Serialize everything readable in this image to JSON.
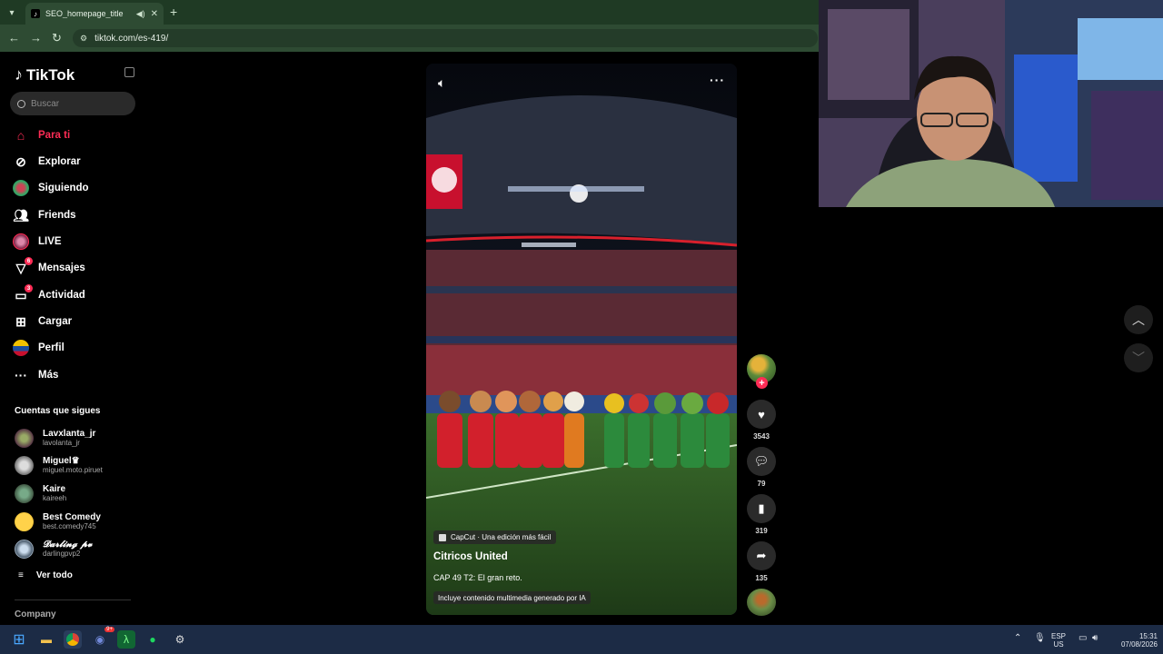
{
  "browser": {
    "tab_title": "SEO_homepage_title",
    "url": "tiktok.com/es-419/",
    "tab_icon": "tiktok-favicon",
    "new_tab": "+"
  },
  "sidebar": {
    "logo": "TikTok",
    "search_placeholder": "Buscar",
    "nav": [
      {
        "label": "Para ti",
        "icon": "home-icon",
        "active": true
      },
      {
        "label": "Explorar",
        "icon": "compass-icon"
      },
      {
        "label": "Siguiendo",
        "icon": "following-avatar-icon"
      },
      {
        "label": "Friends",
        "icon": "friends-icon"
      },
      {
        "label": "LIVE",
        "icon": "live-icon"
      },
      {
        "label": "Mensajes",
        "icon": "messages-icon",
        "badge": "6"
      },
      {
        "label": "Actividad",
        "icon": "activity-icon",
        "badge": "3"
      },
      {
        "label": "Cargar",
        "icon": "upload-icon"
      },
      {
        "label": "Perfil",
        "icon": "profile-avatar-icon"
      },
      {
        "label": "Más",
        "icon": "more-icon"
      }
    ],
    "following_header": "Cuentas que sigues",
    "accounts": [
      {
        "name": "Lavxlanta_jr",
        "username": "lavolanta_jr"
      },
      {
        "name": "Miguel♛",
        "username": "miguel.moto.piruet"
      },
      {
        "name": "Kaire",
        "username": "kaireeh"
      },
      {
        "name": "Best Comedy",
        "username": "best.comedy745"
      },
      {
        "name": "𝓓𝓪𝓻𝓵𝓲𝓷𝓰 𝓹𝓿",
        "username": "darlingpvp2"
      }
    ],
    "see_all": "Ver todo",
    "company": "Company"
  },
  "video": {
    "capcut": "CapCut · Una edición más fácil",
    "title": "Citricos United",
    "description": "CAP 49 T2: El gran reto.",
    "ai_tag": "Incluye contenido multimedia generado por IA"
  },
  "actions": {
    "likes": "3543",
    "comments": "79",
    "saves": "319",
    "shares": "135"
  },
  "taskbar": {
    "lang_top": "ESP",
    "lang_bottom": "US",
    "time": "15:31",
    "date": "07/08/2026",
    "discord_badge": "9+"
  },
  "colors": {
    "accent": "#fe2c55",
    "browser_green": "#2e4b33",
    "taskbar": "#1c2b45"
  }
}
